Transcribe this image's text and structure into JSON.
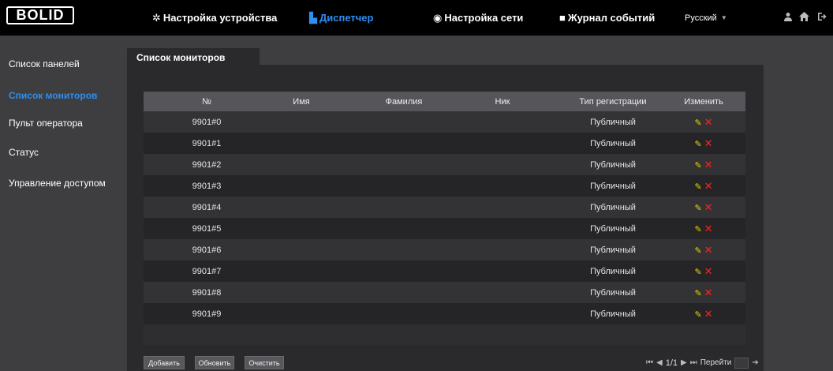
{
  "header": {
    "logo_text": "BOLID",
    "nav": [
      {
        "label": "Настройка устройства",
        "icon": "gear-icon",
        "active": false
      },
      {
        "label": "Диспетчер",
        "icon": "building-icon",
        "active": true
      },
      {
        "label": "Настройка сети",
        "icon": "globe-icon",
        "active": false
      },
      {
        "label": "Журнал событий",
        "icon": "log-icon",
        "active": false
      }
    ],
    "language": "Русский"
  },
  "sidebar": {
    "items": [
      {
        "label": "Список панелей",
        "active": false
      },
      {
        "label": "Список мониторов",
        "active": true
      },
      {
        "label": "Пульт оператора",
        "active": false
      },
      {
        "label": "Статус",
        "active": false
      },
      {
        "label": "Управление доступом",
        "active": false
      }
    ]
  },
  "main": {
    "tab_label": "Список мониторов",
    "table": {
      "headers": [
        "№",
        "Имя",
        "Фамилия",
        "Ник",
        "Тип регистрации",
        "Изменить"
      ],
      "rows": [
        {
          "no": "9901#0",
          "name": "",
          "surname": "",
          "nick": "",
          "reg_type": "Публичный"
        },
        {
          "no": "9901#1",
          "name": "",
          "surname": "",
          "nick": "",
          "reg_type": "Публичный"
        },
        {
          "no": "9901#2",
          "name": "",
          "surname": "",
          "nick": "",
          "reg_type": "Публичный"
        },
        {
          "no": "9901#3",
          "name": "",
          "surname": "",
          "nick": "",
          "reg_type": "Публичный"
        },
        {
          "no": "9901#4",
          "name": "",
          "surname": "",
          "nick": "",
          "reg_type": "Публичный"
        },
        {
          "no": "9901#5",
          "name": "",
          "surname": "",
          "nick": "",
          "reg_type": "Публичный"
        },
        {
          "no": "9901#6",
          "name": "",
          "surname": "",
          "nick": "",
          "reg_type": "Публичный"
        },
        {
          "no": "9901#7",
          "name": "",
          "surname": "",
          "nick": "",
          "reg_type": "Публичный"
        },
        {
          "no": "9901#8",
          "name": "",
          "surname": "",
          "nick": "",
          "reg_type": "Публичный"
        },
        {
          "no": "9901#9",
          "name": "",
          "surname": "",
          "nick": "",
          "reg_type": "Публичный"
        }
      ]
    },
    "buttons": {
      "add": "Добавить",
      "refresh": "Обновить",
      "clear": "Очистить"
    },
    "pager": {
      "page": "1/1",
      "goto_label": "Перейти"
    }
  },
  "colors": {
    "accent": "#2d8ff0",
    "edit_icon": "#f0d000",
    "delete_icon": "#ff2020"
  }
}
